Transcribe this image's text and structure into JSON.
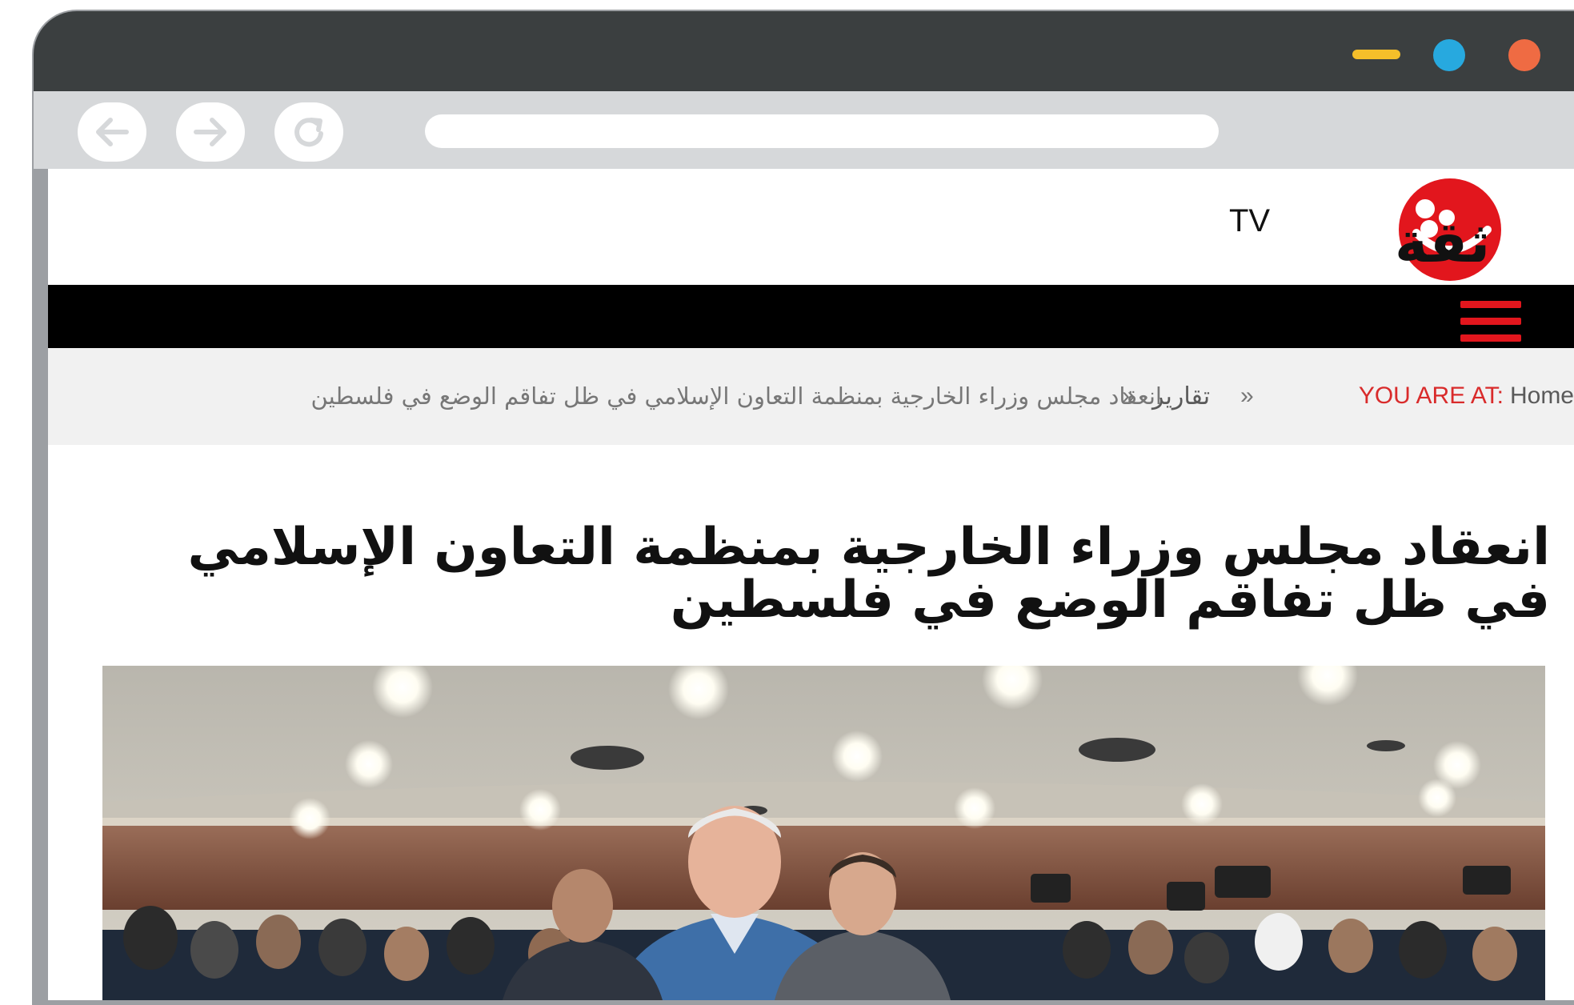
{
  "breadcrumb": {
    "prefix": "YOU ARE AT:",
    "home": "Home",
    "separator": "»",
    "category": "تقارير",
    "current": "انعقاد مجلس وزراء الخارجية بمنظمة التعاون الإسلامي في ظل تفاقم الوضع في فلسطين"
  },
  "article": {
    "title": "انعقاد مجلس وزراء الخارجية بمنظمة التعاون الإسلامي في ظل تفاقم الوضع في فلسطين"
  },
  "logo": {
    "text": "ثقة",
    "suffix": "TV"
  },
  "icons": {
    "back": "arrow-left-icon",
    "forward": "arrow-right-icon",
    "reload": "reload-icon",
    "menu": "hamburger-menu-icon"
  },
  "colors": {
    "brand_red": "#e2161d",
    "navbar": "#000000",
    "breadcrumb_accent": "#d92b2b",
    "titlebar": "#3b3f40",
    "window_minimize": "#f5bf2a",
    "window_maximize": "#27a9df",
    "window_close": "#ef6b43"
  }
}
